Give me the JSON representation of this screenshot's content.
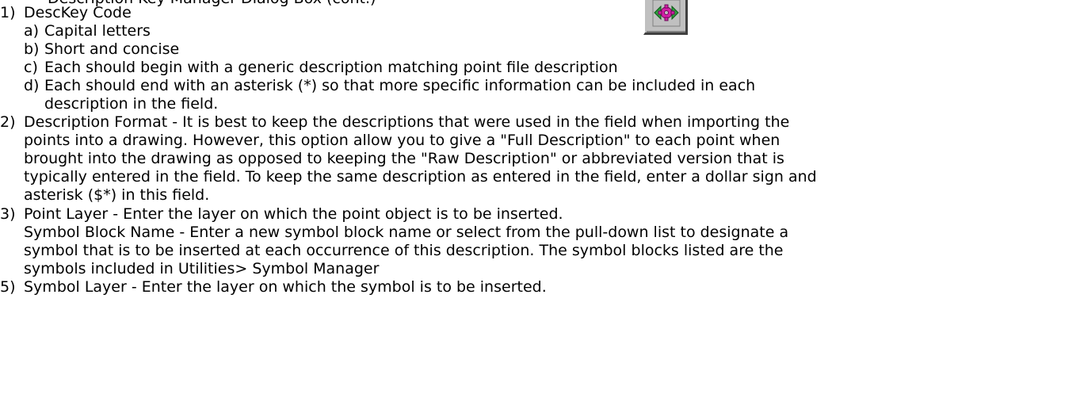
{
  "top_clipped_text": "Description Key Manager Dialog Box (cont.)",
  "toolbar_icon": "description-key-icon",
  "items": [
    {
      "num": "1)",
      "text": "DescKey Code"
    },
    {
      "num": "a)",
      "text": "Capital letters"
    },
    {
      "num": "b)",
      "text": "Short and concise"
    },
    {
      "num": "c)",
      "text": "Each should begin with a generic description matching point file description"
    },
    {
      "num": "d)",
      "text": "Each should end with an asterisk (*) so that more specific information can be included in each"
    },
    {
      "num": "",
      "text": "description in the field."
    },
    {
      "num": "2)",
      "text": "Description Format - It is best to keep the descriptions that were used in the field when importing the"
    },
    {
      "num": "",
      "text": "points into a drawing.  However, this option allow you to give a \"Full Description\" to each point when"
    },
    {
      "num": "",
      "text": "brought into the drawing as opposed to keeping the \"Raw Description\" or abbreviated version that is"
    },
    {
      "num": "",
      "text": "typically entered in the field.  To keep the same description as entered in the field, enter a dollar sign and"
    },
    {
      "num": "",
      "text": "asterisk ($*) in this field."
    },
    {
      "num": "3)",
      "text": "Point Layer - Enter the layer on which the point object is to be inserted."
    },
    {
      "num": "",
      "text": "Symbol Block Name - Enter a new symbol block name or select from the pull-down list to designate a"
    },
    {
      "num": "",
      "text": "symbol that is to be inserted at each occurrence of this description.  The symbol blocks listed are the"
    },
    {
      "num": "",
      "text": "symbols included in Utilities> Symbol Manager"
    },
    {
      "num": "5)",
      "text": "Symbol Layer -  Enter the layer on which the symbol is to be inserted."
    }
  ]
}
